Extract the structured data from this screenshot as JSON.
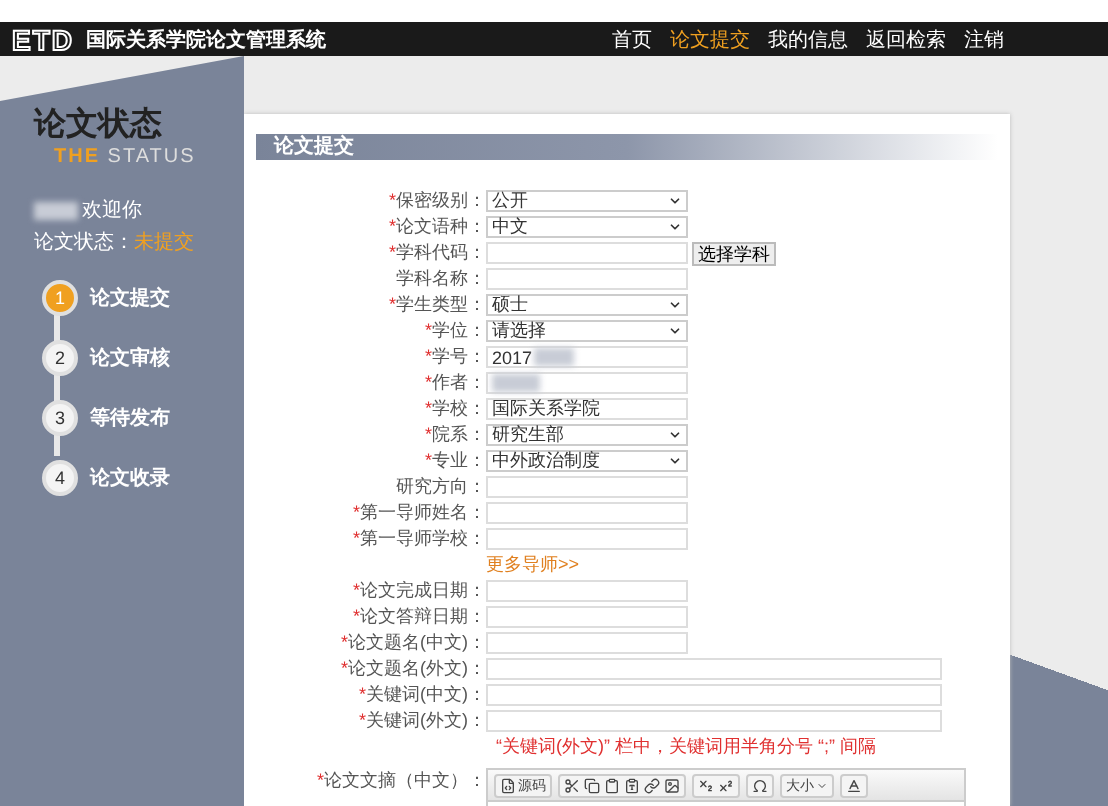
{
  "header": {
    "logo": "ETD",
    "title": "国际关系学院论文管理系统",
    "nav": [
      {
        "label": "首页",
        "selected": false
      },
      {
        "label": "论文提交",
        "selected": true
      },
      {
        "label": "我的信息",
        "selected": false
      },
      {
        "label": "返回检索",
        "selected": false
      },
      {
        "label": "注销",
        "selected": false
      }
    ]
  },
  "sidebar": {
    "title": "论文状态",
    "subtitle_lead": "THE",
    "subtitle_rest": "STATUS",
    "welcome": "欢迎你",
    "status_label": "论文状态：",
    "status_value": "未提交",
    "steps": [
      {
        "number": "1",
        "label": "论文提交",
        "selected": true
      },
      {
        "number": "2",
        "label": "论文审核",
        "selected": false
      },
      {
        "number": "3",
        "label": "等待发布",
        "selected": false
      },
      {
        "number": "4",
        "label": "论文收录",
        "selected": false
      }
    ]
  },
  "panel": {
    "title": "论文提交",
    "rows": [
      {
        "kind": "select",
        "mark": "*",
        "label": "保密级别：",
        "value": "公开"
      },
      {
        "kind": "select",
        "mark": "*",
        "label": "论文语种：",
        "value": "中文"
      },
      {
        "kind": "input",
        "mark": "*",
        "label": "学科代码：",
        "button": "选择学科",
        "wide": false,
        "blurred": false
      },
      {
        "kind": "input",
        "label": "学科名称：",
        "wide": false,
        "blurred": false
      },
      {
        "kind": "select",
        "mark": "*",
        "label": "学生类型：",
        "value": "硕士"
      },
      {
        "kind": "select",
        "mark": "*",
        "label": "学位：",
        "value": "请选择"
      },
      {
        "kind": "input",
        "mark": "*",
        "label": "学号：",
        "value": "2017",
        "wide": false,
        "blurred": true
      },
      {
        "kind": "input",
        "mark": "*",
        "label": "作者：",
        "wide": false,
        "blurred": true
      },
      {
        "kind": "input",
        "mark": "*",
        "label": "学校：",
        "value": "国际关系学院",
        "wide": false,
        "blurred": false
      },
      {
        "kind": "select",
        "mark": "*",
        "label": "院系：",
        "value": "研究生部"
      },
      {
        "kind": "select",
        "mark": "*",
        "label": "专业：",
        "value": "中外政治制度"
      },
      {
        "kind": "input",
        "label": "研究方向：",
        "wide": false,
        "blurred": false
      },
      {
        "kind": "input",
        "mark": "*",
        "label": "第一导师姓名：",
        "wide": false,
        "blurred": false
      },
      {
        "kind": "input",
        "mark": "*",
        "label": "第一导师学校：",
        "wide": false,
        "blurred": false
      },
      {
        "kind": "link",
        "label": "更多导师>>"
      },
      {
        "kind": "input",
        "mark": "*",
        "label": "论文完成日期：",
        "wide": false,
        "blurred": false
      },
      {
        "kind": "input",
        "mark": "*",
        "label": "论文答辩日期：",
        "wide": false,
        "blurred": false
      },
      {
        "kind": "input",
        "mark": "*",
        "label": "论文题名(中文)：",
        "wide": false,
        "blurred": false
      },
      {
        "kind": "input",
        "mark": "*",
        "label": "论文题名(外文)：",
        "wide": true,
        "blurred": false
      },
      {
        "kind": "input",
        "mark": "*",
        "label": "关键词(中文)：",
        "wide": true,
        "blurred": false
      },
      {
        "kind": "input",
        "mark": "*",
        "label": "关键词(外文)：",
        "wide": true,
        "blurred": false
      },
      {
        "kind": "note",
        "label": "“关键词(外文)” 栏中，关键词用半角分号 “;” 间隔"
      },
      {
        "kind": "editor",
        "mark": "*",
        "label": "论文文摘（中文）：",
        "source_button": "源码",
        "size_menu": "大小"
      }
    ]
  }
}
